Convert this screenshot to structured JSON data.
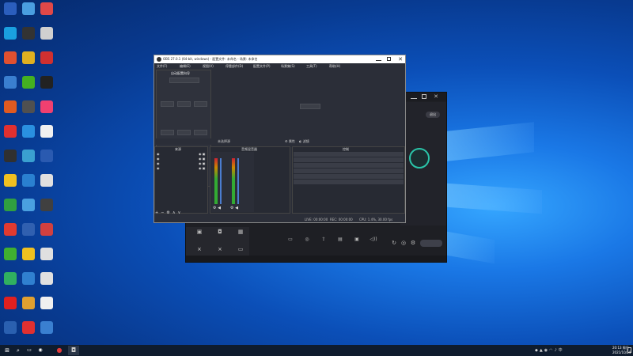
{
  "desktop": {
    "colors": {
      "accent": "#1a78e6",
      "taskbar": "#0f1c2e"
    },
    "icons": [
      {
        "col": 0,
        "row": 0,
        "label": "",
        "color": "#2b5ebd"
      },
      {
        "col": 1,
        "row": 0,
        "label": "",
        "color": "#4a9ee0"
      },
      {
        "col": 2,
        "row": 0,
        "label": "",
        "color": "#e04848"
      },
      {
        "col": 0,
        "row": 1,
        "label": "",
        "color": "#1aa0e0"
      },
      {
        "col": 1,
        "row": 1,
        "label": "",
        "color": "#333333"
      },
      {
        "col": 2,
        "row": 1,
        "label": "",
        "color": "#d0d0d0"
      },
      {
        "col": 0,
        "row": 2,
        "label": "",
        "color": "#e05030"
      },
      {
        "col": 1,
        "row": 2,
        "label": "",
        "color": "#e0b020"
      },
      {
        "col": 2,
        "row": 2,
        "label": "",
        "color": "#d03030"
      },
      {
        "col": 0,
        "row": 3,
        "label": "",
        "color": "#3a7fd0"
      },
      {
        "col": 1,
        "row": 3,
        "label": "",
        "color": "#44b020"
      },
      {
        "col": 2,
        "row": 3,
        "label": "",
        "color": "#222222"
      },
      {
        "col": 0,
        "row": 4,
        "label": "",
        "color": "#e05a20"
      },
      {
        "col": 1,
        "row": 4,
        "label": "",
        "color": "#505050"
      },
      {
        "col": 2,
        "row": 4,
        "label": "",
        "color": "#f04070"
      },
      {
        "col": 0,
        "row": 5,
        "label": "",
        "color": "#e03030"
      },
      {
        "col": 1,
        "row": 5,
        "label": "",
        "color": "#2a90e0"
      },
      {
        "col": 2,
        "row": 5,
        "label": "",
        "color": "#f0f0f0"
      },
      {
        "col": 0,
        "row": 6,
        "label": "",
        "color": "#303030"
      },
      {
        "col": 1,
        "row": 6,
        "label": "",
        "color": "#3aa0d0"
      },
      {
        "col": 2,
        "row": 6,
        "label": "",
        "color": "#2a5ab0"
      },
      {
        "col": 0,
        "row": 7,
        "label": "",
        "color": "#f0c020"
      },
      {
        "col": 1,
        "row": 7,
        "label": "",
        "color": "#2a80d0"
      },
      {
        "col": 2,
        "row": 7,
        "label": "",
        "color": "#e0e0e0"
      },
      {
        "col": 0,
        "row": 8,
        "label": "",
        "color": "#30a040"
      },
      {
        "col": 1,
        "row": 8,
        "label": "",
        "color": "#4aa0e0"
      },
      {
        "col": 2,
        "row": 8,
        "label": "",
        "color": "#404040"
      },
      {
        "col": 0,
        "row": 9,
        "label": "",
        "color": "#e03a30"
      },
      {
        "col": 1,
        "row": 9,
        "label": "",
        "color": "#3060b0"
      },
      {
        "col": 2,
        "row": 9,
        "label": "",
        "color": "#d04040"
      },
      {
        "col": 0,
        "row": 10,
        "label": "",
        "color": "#40b030"
      },
      {
        "col": 1,
        "row": 10,
        "label": "",
        "color": "#f0c020"
      },
      {
        "col": 2,
        "row": 10,
        "label": "",
        "color": "#e0e0e0"
      },
      {
        "col": 0,
        "row": 11,
        "label": "",
        "color": "#30b060"
      },
      {
        "col": 1,
        "row": 11,
        "label": "",
        "color": "#3080d0"
      },
      {
        "col": 2,
        "row": 11,
        "label": "",
        "color": "#e0e0e0"
      },
      {
        "col": 0,
        "row": 12,
        "label": "",
        "color": "#e02020"
      },
      {
        "col": 1,
        "row": 12,
        "label": "",
        "color": "#e0a030"
      },
      {
        "col": 2,
        "row": 12,
        "label": "",
        "color": "#f0f0f0"
      },
      {
        "col": 0,
        "row": 13,
        "label": "",
        "color": "#2a60b0"
      },
      {
        "col": 1,
        "row": 13,
        "label": "",
        "color": "#e03030"
      },
      {
        "col": 2,
        "row": 13,
        "label": "",
        "color": "#3a7fd0"
      }
    ]
  },
  "background_app": {
    "colors": {
      "bg": "#1e1f24",
      "panel": "#2a2b31"
    },
    "title": "",
    "top_pill": "退出",
    "live_circle_label": "",
    "status_text": "",
    "bottom_left_tabs": [
      {
        "icon": "square-icon",
        "label": "",
        "top": false
      },
      {
        "icon": "camera-icon",
        "label": "",
        "top": false
      },
      {
        "icon": "grid-icon",
        "label": "",
        "top": false
      },
      {
        "icon": "network-icon",
        "label": "",
        "top": true
      },
      {
        "icon": "tree-icon",
        "label": "",
        "top": true
      },
      {
        "icon": "card-icon",
        "label": "",
        "top": true
      }
    ],
    "toolbar": [
      {
        "icon": "monitor-icon",
        "label": ""
      },
      {
        "icon": "camera-icon",
        "label": ""
      },
      {
        "icon": "upload-icon",
        "label": ""
      },
      {
        "icon": "file-icon",
        "label": ""
      },
      {
        "icon": "box-icon",
        "label": ""
      },
      {
        "icon": "sound-icon",
        "label": ""
      }
    ],
    "right_actions": [
      {
        "icon": "refresh-icon"
      },
      {
        "icon": "layers-icon"
      },
      {
        "icon": "gear-icon"
      }
    ],
    "go_live": "",
    "footer_notice": "",
    "footer_stats": ""
  },
  "obs": {
    "colors": {
      "bg": "#2b2e38",
      "dock": "#272a33",
      "title_bg": "#ffffff",
      "accent": "#4b7dd0"
    },
    "window_title": "OBS 27.0.1 (64-bit, windows) - 配置文件: 未命名 - 场景: 未命名",
    "menu": [
      "文件(F)",
      "编辑(E)",
      "视图(V)",
      "停靠部件(D)",
      "配置文件(P)",
      "场景集(S)",
      "工具(T)",
      "帮助(H)"
    ],
    "dialog": {
      "title": "自动配置向导",
      "lines": [
        ""
      ],
      "sections": [
        {
          "title": "",
          "buttons": [
            "",
            "",
            ""
          ]
        },
        {
          "title": "",
          "buttons": [
            "",
            "",
            ""
          ]
        }
      ]
    },
    "preview": {
      "text": "",
      "button": ""
    },
    "scene_bar": {
      "label": "未选择源",
      "props": "属性",
      "filters": "滤镜"
    },
    "docks": {
      "sources_title": "来源",
      "mixer_title": "音频混音器",
      "controls_title": "控制",
      "sources": [
        "",
        "",
        "",
        ""
      ],
      "mixer_channels": [
        "",
        ""
      ],
      "controls": [
        "",
        "",
        "",
        "",
        "",
        ""
      ]
    },
    "status": {
      "live": "LIVE: 00:00:00",
      "rec": "REC: 00:00:00",
      "cpu": "CPU: 1.4%, 30.00 fps"
    }
  },
  "taskbar": {
    "apps": [
      {
        "icon": "start-icon"
      },
      {
        "icon": "search-icon"
      },
      {
        "icon": "taskview-icon"
      },
      {
        "icon": "edge-icon"
      },
      {
        "icon": "obs-icon"
      },
      {
        "icon": "app-icon"
      }
    ],
    "time": "20:13 周日",
    "date": "2021/10/24"
  }
}
